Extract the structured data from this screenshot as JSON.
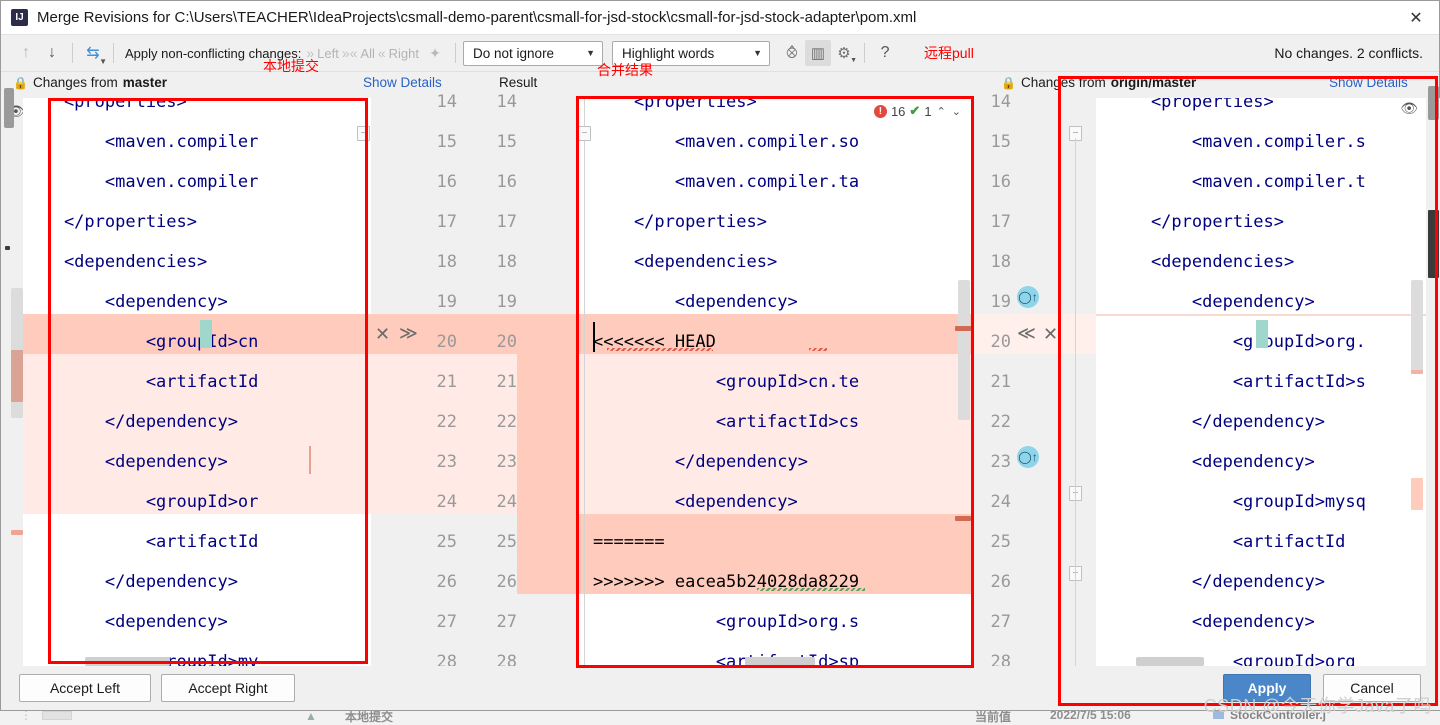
{
  "window": {
    "app_icon_label": "IJ",
    "title": "Merge Revisions for C:\\Users\\TEACHER\\IdeaProjects\\csmall-demo-parent\\csmall-for-jsd-stock\\csmall-for-jsd-stock-adapter\\pom.xml",
    "close_label": "✕"
  },
  "toolbar": {
    "prev_label": "↑",
    "next_label": "↓",
    "apply_all_icon_label": "⇆",
    "apply_text": "Apply non-conflicting changes:",
    "left_label": "Left",
    "all_label": "All",
    "right_label": "Right",
    "magic_label": "✦",
    "ignore_policy": "Do not ignore",
    "highlight_policy": "Highlight words",
    "collapse_label": "⨶",
    "columns_label": "▥",
    "settings_label": "⚙",
    "help_label": "?",
    "remote_note": "远程pull",
    "status": "No changes. 2 conflicts."
  },
  "headers": {
    "left_lock": "🔒",
    "left_title_prefix": "Changes from ",
    "left_title_branch": "master",
    "left_show_details": "Show Details",
    "result_label": "Result",
    "right_lock": "🔒",
    "right_title_prefix": "Changes from ",
    "right_title_branch": "origin/master",
    "right_show_details": "Show Details",
    "note_local_commit": "本地提交",
    "note_merge_result": "合并结果"
  },
  "line_numbers_left": [
    "14",
    "15",
    "16",
    "17",
    "18",
    "19",
    "20",
    "21",
    "22",
    "23",
    "24",
    "25",
    "26",
    "27",
    "28"
  ],
  "line_numbers_right": [
    "14",
    "15",
    "16",
    "17",
    "18",
    "19",
    "20",
    "21",
    "22",
    "23",
    "24",
    "25",
    "26",
    "27",
    "28"
  ],
  "left_pane": {
    "lines": [
      {
        "text": "    <properties>",
        "bg": "white"
      },
      {
        "text": "        <maven.compiler",
        "bg": "white"
      },
      {
        "text": "        <maven.compiler",
        "bg": "white"
      },
      {
        "text": "    </properties>",
        "bg": "white"
      },
      {
        "text": "    <dependencies>",
        "bg": "white"
      },
      {
        "text": "        <dependency>",
        "bg": "white"
      },
      {
        "text": "            <groupId>cn",
        "bg": "pinkdark"
      },
      {
        "text": "            <artifactId",
        "bg": "pinklight"
      },
      {
        "text": "        </dependency>",
        "bg": "pinklight"
      },
      {
        "text": "        <dependency>",
        "bg": "pinklight"
      },
      {
        "text": "            <groupId>or",
        "bg": "white"
      },
      {
        "text": "            <artifactId",
        "bg": "white"
      },
      {
        "text": "        </dependency>",
        "bg": "white"
      },
      {
        "text": "        <dependency>",
        "bg": "white"
      },
      {
        "text": "            <groupId>my",
        "bg": "white"
      }
    ]
  },
  "middle_pane": {
    "lines": [
      {
        "text": "    <properties>",
        "bg": "white"
      },
      {
        "text": "        <maven.compiler.so",
        "bg": "white"
      },
      {
        "text": "        <maven.compiler.ta",
        "bg": "white"
      },
      {
        "text": "    </properties>",
        "bg": "white"
      },
      {
        "text": "    <dependencies>",
        "bg": "white"
      },
      {
        "text": "        <dependency>",
        "bg": "white"
      },
      {
        "text": "<<<<<<< HEAD",
        "bg": "pinkdark"
      },
      {
        "text": "            <groupId>cn.te",
        "bg": "pinklight"
      },
      {
        "text": "            <artifactId>cs",
        "bg": "pinklight"
      },
      {
        "text": "        </dependency>",
        "bg": "pinklight"
      },
      {
        "text": "        <dependency>",
        "bg": "pinklight"
      },
      {
        "text": "=======",
        "bg": "pinkdark"
      },
      {
        "text": ">>>>>>> eacea5b24028da8229",
        "bg": "pinkdark"
      },
      {
        "text": "            <groupId>org.s",
        "bg": "white"
      },
      {
        "text": "            <artifactId>sp",
        "bg": "white"
      }
    ],
    "inspection": {
      "error_icon": "!",
      "error_count": "16",
      "check_icon": "✔",
      "check_count": "1",
      "up": "⌃",
      "down": "⌄"
    }
  },
  "right_pane": {
    "lines": [
      {
        "text": "    <properties>",
        "bg": "white"
      },
      {
        "text": "        <maven.compiler.s",
        "bg": "white"
      },
      {
        "text": "        <maven.compiler.t",
        "bg": "white"
      },
      {
        "text": "    </properties>",
        "bg": "white"
      },
      {
        "text": "    <dependencies>",
        "bg": "white"
      },
      {
        "text": "        <dependency>",
        "bg": "white"
      },
      {
        "text": "            <groupId>org.",
        "bg": "white"
      },
      {
        "text": "            <artifactId>s",
        "bg": "white"
      },
      {
        "text": "        </dependency>",
        "bg": "white"
      },
      {
        "text": "        <dependency>",
        "bg": "white"
      },
      {
        "text": "            <groupId>mysq",
        "bg": "white"
      },
      {
        "text": "            <artifactId",
        "bg": "white"
      },
      {
        "text": "        </dependency>",
        "bg": "white"
      },
      {
        "text": "        <dependency>",
        "bg": "white"
      },
      {
        "text": "            <groupId>org",
        "bg": "white"
      }
    ]
  },
  "diff_actions": {
    "left_revert": "✕",
    "left_accept": "≫",
    "right_accept": "≪",
    "right_revert": "✕"
  },
  "buttons": {
    "accept_left": "Accept Left",
    "accept_right": "Accept Right",
    "apply": "Apply",
    "cancel": "Cancel"
  },
  "watermark": "CSDN @今天你学Java了吗",
  "ide_background": {
    "label_local_commit": "本地提交",
    "label_current_value": "当前值",
    "timestamp": "2022/7/5 15:06",
    "file_tab": "StockController.j"
  },
  "colors": {
    "accent": "#4a86c8",
    "annotation_red": "#ff0000",
    "diff_dark": "#ffcbbd",
    "diff_light": "#ffeae6",
    "tag_blue": "#0000ff",
    "link_blue": "#2962c4",
    "gutter_icon": "#8ed5ec"
  }
}
